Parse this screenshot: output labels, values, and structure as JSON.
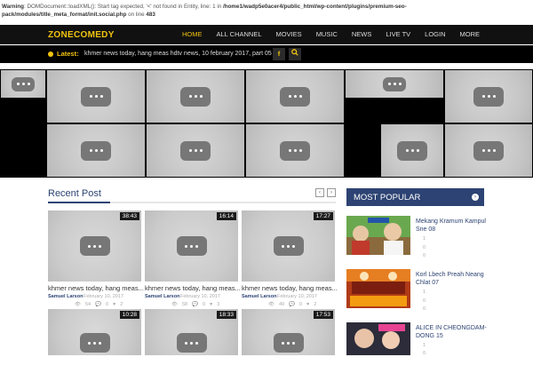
{
  "warning": {
    "prefix": "Warning",
    "message": ": DOMDocument::loadXML(): Start tag expected, '<' not found in Entity, line: 1 in ",
    "path": "/home1/wadp5e0acer4/public_html/wp-content/plugins/premium-seo-pack/modules/title_meta_format/init.social.php",
    "line_text": " on line ",
    "line_no": "483"
  },
  "header": {
    "logo": "ZONECOMEDY",
    "menu": [
      "HOME",
      "ALL CHANNEL",
      "MOVIES",
      "MUSIC",
      "NEWS",
      "LIVE TV",
      "LOGIN",
      "MORE"
    ],
    "active_index": 0
  },
  "ticker": {
    "label": "Latest:",
    "text": "khmer news today, hang meas hdtv news, 10 february 2017, part 05",
    "facebook_glyph": "f",
    "search_icon": "search-icon"
  },
  "recent": {
    "title": "Recent Post",
    "prev_glyph": "‹",
    "next_glyph": "›",
    "cards": [
      {
        "duration": "38:43",
        "title": "khmer news today, hang meas...",
        "author": "Samuel Larson",
        "date": "February 10, 2017",
        "views": "54",
        "comments": "0",
        "likes": "2"
      },
      {
        "duration": "16:14",
        "title": "khmer news today, hang meas...",
        "author": "Samuel Larson",
        "date": "February 10, 2017",
        "views": "58",
        "comments": "0",
        "likes": "3"
      },
      {
        "duration": "17:27",
        "title": "khmer news today, hang meas...",
        "author": "Samuel Larson",
        "date": "February 10, 2017",
        "views": "49",
        "comments": "0",
        "likes": "2"
      },
      {
        "duration": "10:28"
      },
      {
        "duration": "18:33"
      },
      {
        "duration": "17:53"
      }
    ]
  },
  "popular": {
    "title": "MOST POPULAR",
    "arrow_glyph": "›",
    "items": [
      {
        "title": "Mekang Kramum Kampul Sne 08",
        "views": "1",
        "comments": "0",
        "likes": "0"
      },
      {
        "title": "Korl Lbech Preah Neang Chlat 07",
        "views": "1",
        "comments": "0",
        "likes": "0"
      },
      {
        "title": "ALICE IN CHEONGDAM-DONG 15",
        "views": "1",
        "comments": "0"
      }
    ]
  }
}
